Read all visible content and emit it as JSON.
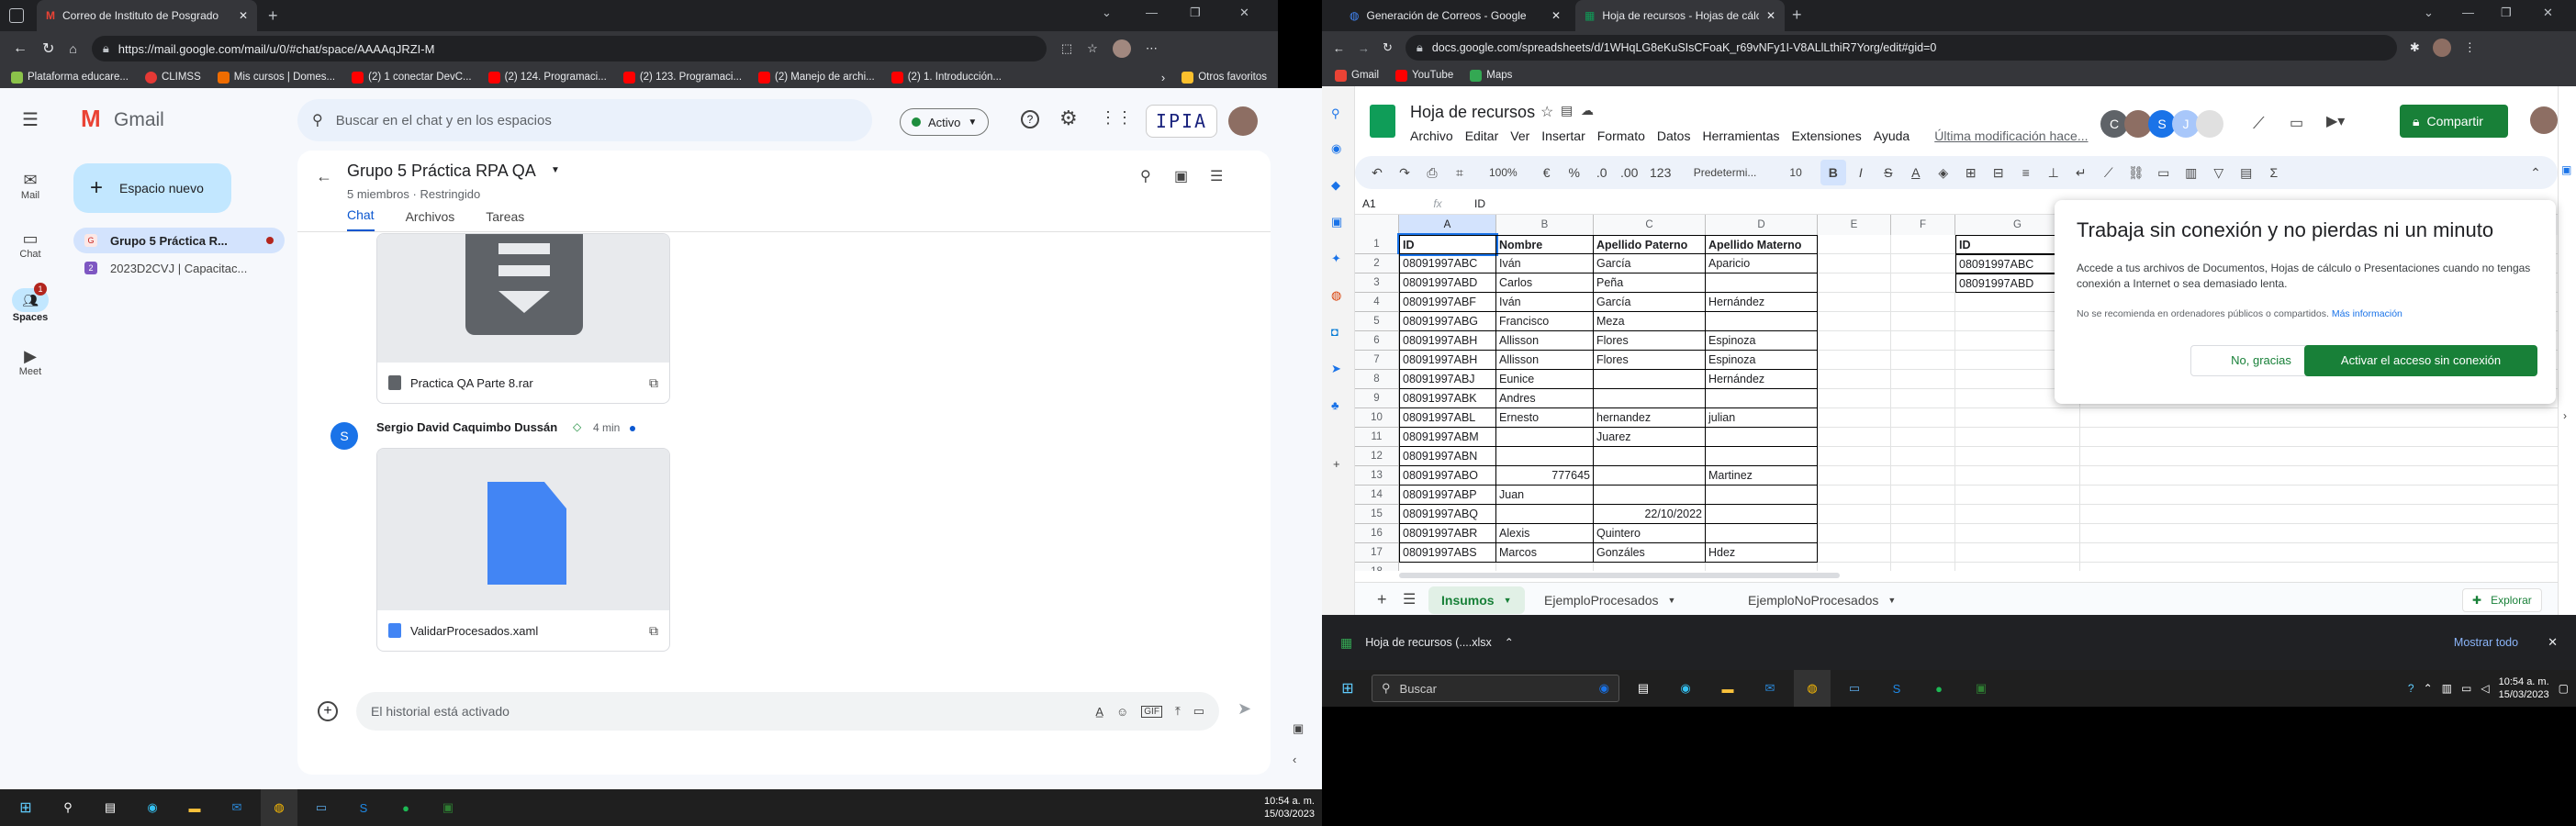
{
  "left_browser": {
    "tab_title": "Correo de Instituto de Posgrado",
    "url": "https://mail.google.com/mail/u/0/#chat/space/AAAAqJRZI-M",
    "bookmarks": [
      "Plataforma educare...",
      "CLIMSS",
      "Mis cursos | Domes...",
      "(2) 1 conectar DevC...",
      "(2) 124. Programaci...",
      "(2) 123. Programaci...",
      "(2) Manejo de archi...",
      "(2) 1. Introducción..."
    ],
    "other_bookmarks": "Otros favoritos"
  },
  "gmail": {
    "logo_text": "Gmail",
    "search_placeholder": "Buscar en el chat y en los espacios",
    "status": "Activo",
    "account_badge": "IPIA",
    "new_space": "Espacio nuevo",
    "rail": [
      {
        "label": "Mail"
      },
      {
        "label": "Chat"
      },
      {
        "label": "Spaces",
        "badge": "1"
      },
      {
        "label": "Meet"
      }
    ],
    "spaces": [
      {
        "name": "Grupo 5 Práctica R...",
        "initial": "G"
      },
      {
        "name": "2023D2CVJ | Capacitac...",
        "initial": "2"
      }
    ],
    "space_title": "Grupo 5 Práctica RPA QA",
    "space_meta": "5 miembros · Restringido",
    "tabs": [
      "Chat",
      "Archivos",
      "Tareas"
    ],
    "file1": "Practica QA Parte 8.rar",
    "sender": "Sergio David Caquimbo Dussán",
    "sender_initial": "S",
    "time": "4 min",
    "file2": "ValidarProcesados.xaml",
    "composer_placeholder": "El historial está activado"
  },
  "left_taskbar": {
    "time": "10:54 a. m.",
    "date": "15/03/2023"
  },
  "right_browser": {
    "tabs": [
      "Generación de Correos - Google",
      "Hoja de recursos - Hojas de cálc"
    ],
    "url": "docs.google.com/spreadsheets/d/1WHqLG8eKuSIsCFoaK_r69vNFy1I-V8ALlLthiR7Yorg/edit#gid=0",
    "bookmarks": [
      "Gmail",
      "YouTube",
      "Maps"
    ]
  },
  "sheets": {
    "title": "Hoja de recursos",
    "menus": [
      "Archivo",
      "Editar",
      "Ver",
      "Insertar",
      "Formato",
      "Datos",
      "Herramientas",
      "Extensiones",
      "Ayuda"
    ],
    "last_edit": "Última modificación hace...",
    "share": "Compartir",
    "zoom": "100%",
    "font": "Predetermi...",
    "font_size": "10",
    "fmt_currency": "€",
    "fmt_percent": "%",
    "fmt_dec_less": ".0",
    "fmt_dec_more": ".00",
    "fmt_more": "123",
    "cell_ref": "A1",
    "formula": "ID",
    "columns": [
      "A",
      "B",
      "C",
      "D",
      "E",
      "F",
      "G"
    ],
    "headers": [
      "ID",
      "Nombre",
      "Apellido Paterno",
      "Apellido Materno"
    ],
    "rows": [
      [
        "08091997ABC",
        "Iván",
        "García",
        "Aparicio"
      ],
      [
        "08091997ABD",
        "Carlos",
        "Peña",
        ""
      ],
      [
        "08091997ABF",
        "Iván",
        "García",
        "Hernández"
      ],
      [
        "08091997ABG",
        "Francisco",
        "Meza",
        ""
      ],
      [
        "08091997ABH",
        "Allisson",
        "Flores",
        "Espinoza"
      ],
      [
        "08091997ABH",
        "Allisson",
        "Flores",
        "Espinoza"
      ],
      [
        "08091997ABJ",
        "Eunice",
        "",
        "Hernández"
      ],
      [
        "08091997ABK",
        "Andres",
        "",
        ""
      ],
      [
        "08091997ABL",
        "Ernesto",
        "hernandez",
        "julian"
      ],
      [
        "08091997ABM",
        "",
        "Juarez",
        ""
      ],
      [
        "08091997ABN",
        "",
        "",
        ""
      ],
      [
        "08091997ABO",
        "777645",
        "",
        "Martinez"
      ],
      [
        "08091997ABP",
        "Juan",
        "",
        ""
      ],
      [
        "08091997ABQ",
        "",
        "22/10/2022",
        ""
      ],
      [
        "08091997ABR",
        "Alexis",
        "Quintero",
        ""
      ],
      [
        "08091997ABS",
        "Marcos",
        "Gonzáles",
        "Hdez"
      ]
    ],
    "g_column": [
      "ID",
      "08091997ABC",
      "08091997ABD"
    ],
    "sheet_tabs": [
      "Insumos",
      "EjemploProcesados",
      "EjemploNoProcesados"
    ],
    "explore": "Explorar",
    "popup": {
      "title": "Trabaja sin conexión y no pierdas ni un minuto",
      "body": "Accede a tus archivos de Documentos, Hojas de cálculo o Presentaciones cuando no tengas conexión a Internet o sea demasiado lenta.",
      "note": "No se recomienda en ordenadores públicos o compartidos.",
      "note_link": "Más información",
      "no": "No, gracias",
      "yes": "Activar el acceso sin conexión"
    }
  },
  "download": {
    "file": "Hoja de recursos (....xlsx",
    "show_all": "Mostrar todo"
  },
  "right_taskbar": {
    "search": "Buscar",
    "time": "10:54 a. m.",
    "date": "15/03/2023"
  },
  "colors": {
    "gmail_blue": "#0b57d0",
    "sheets_green": "#188038",
    "active_tab": "#c2e7ff"
  }
}
